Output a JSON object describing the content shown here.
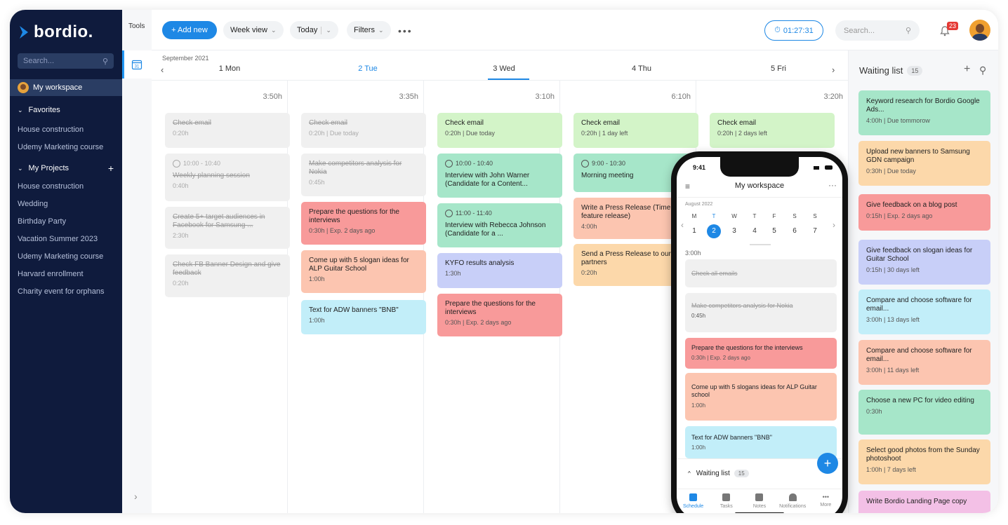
{
  "brand": {
    "name": "bordio.",
    "accent": "#1e88e5"
  },
  "sidebar": {
    "search_placeholder": "Search...",
    "workspace": "My workspace",
    "favorites_label": "Favorites",
    "favorites": [
      "House construction",
      "Udemy Marketing course"
    ],
    "projects_label": "My Projects",
    "projects": [
      "House construction",
      "Wedding",
      "Birthday Party",
      "Vacation Summer 2023",
      "Udemy Marketing course",
      "Harvard enrollment",
      "Charity event for orphans"
    ]
  },
  "tools": {
    "label": "Tools",
    "calendar_day": "31"
  },
  "toolbar": {
    "add_label": "+ Add new",
    "view_label": "Week view",
    "today_label": "Today",
    "filters_label": "Filters",
    "timer": "01:27:31",
    "search_placeholder": "Search...",
    "notifications_count": "23"
  },
  "calendar": {
    "month": "September 2021",
    "days": [
      {
        "label": "1 Mon",
        "total": "3:50h"
      },
      {
        "label": "2 Tue",
        "total": "3:35h"
      },
      {
        "label": "3 Wed",
        "total": "3:10h"
      },
      {
        "label": "4 Thu",
        "total": "6:10h"
      },
      {
        "label": "5 Fri",
        "total": "3:20h"
      }
    ],
    "cards": {
      "mon": [
        {
          "title": "Check email",
          "meta": "0:20h"
        },
        {
          "time": "10:00 - 10:40",
          "title": "Weekly planning session",
          "meta": "0:40h"
        },
        {
          "title": "Create 5+ target audiences in Facebook for Samsung ...",
          "meta": "2:30h"
        },
        {
          "title": "Check FB Banner Design and give feedback",
          "meta": "0:20h"
        }
      ],
      "tue": [
        {
          "title": "Check email",
          "meta": "0:20h | Due today"
        },
        {
          "title": "Make competitors analysis for Nokia",
          "meta": "0:45h"
        },
        {
          "title": "Prepare the questions for the interviews",
          "meta": "0:30h | Exp. 2 days ago"
        },
        {
          "title": "Come up with 5 slogan ideas for ALP Guitar School",
          "meta": "1:00h"
        },
        {
          "title": "Text for ADW banners \"BNB\"",
          "meta": "1:00h"
        }
      ],
      "wed": [
        {
          "title": "Check email",
          "meta": "0:20h | Due today"
        },
        {
          "time": "10:00 - 10:40",
          "title": "Interview with John Warner (Candidate for a Content..."
        },
        {
          "time": "11:00 - 11:40",
          "title": "Interview with Rebecca Johnson (Candidate for a ..."
        },
        {
          "title": "KYFO results analysis",
          "meta": "1:30h"
        },
        {
          "title": "Prepare the questions for the interviews",
          "meta": "0:30h | Exp. 2 days ago"
        }
      ],
      "thu": [
        {
          "title": "Check email",
          "meta": "0:20h | 1 day left"
        },
        {
          "time": "9:00 - 10:30",
          "title": "Morning meeting"
        },
        {
          "title": "Write a Press Release (Time feature release)",
          "meta": "4:00h"
        },
        {
          "title": "Send a Press Release to our partners",
          "meta": "0:20h"
        }
      ],
      "fri": [
        {
          "title": "Check email",
          "meta": "0:20h | 2 days left"
        }
      ]
    }
  },
  "waiting_list": {
    "title": "Waiting list",
    "count": "15",
    "items": [
      {
        "title": "Keyword research for Bordio Google Ads...",
        "meta": "4:00h | Due tommorow",
        "color": "#a6e6c9"
      },
      {
        "title": "Upload new banners to Samsung GDN campaign",
        "meta": "0:30h | Due today",
        "color": "#fcd8aa"
      },
      {
        "title": "Give feedback on a blog post",
        "meta": "0:15h | Exp. 2 days ago",
        "color": "#f89a9a"
      },
      {
        "title": "Give feedback on slogan ideas for Guitar School",
        "meta": "0:15h | 30 days left",
        "color": "#c8cff8"
      },
      {
        "title": "Compare and choose software for email...",
        "meta": "3:00h | 13 days left",
        "color": "#c2eef9"
      },
      {
        "title": "Compare and choose software for email...",
        "meta": "3:00h | 11 days left",
        "color": "#fcc5b0"
      },
      {
        "title": "Choose a new PC for video editing",
        "meta": "0:30h",
        "color": "#a6e6c9"
      },
      {
        "title": "Select good photos from the Sunday photoshoot",
        "meta": "1:00h | 7 days left",
        "color": "#fcd8aa"
      },
      {
        "title": "Write Bordio Landing Page copy",
        "meta": "",
        "color": "#f3c0e6"
      }
    ]
  },
  "phone": {
    "time": "9:41",
    "title": "My workspace",
    "month": "August 2022",
    "weekdays": [
      "M",
      "T",
      "W",
      "T",
      "F",
      "S",
      "S"
    ],
    "dates": [
      "1",
      "2",
      "3",
      "4",
      "5",
      "6",
      "7"
    ],
    "selected_index": 1,
    "total": "3:00h",
    "cards": [
      {
        "title": "Check all emails",
        "meta": ""
      },
      {
        "title": "Make competitors analysis for Nokia",
        "meta": "0:45h"
      },
      {
        "title": "Prepare the questions for the interviews",
        "meta": "0:30h | Exp. 2 days ago"
      },
      {
        "title": "Come up with 5 slogans ideas for ALP Guitar school",
        "meta": "1:00h"
      },
      {
        "title": "Text for ADW banners \"BNB\"",
        "meta": "1:00h"
      }
    ],
    "waiting_label": "Waiting list",
    "waiting_count": "15",
    "nav": [
      "Schedule",
      "Tasks",
      "Notes",
      "Notifications",
      "More"
    ],
    "nav_day": "13"
  }
}
